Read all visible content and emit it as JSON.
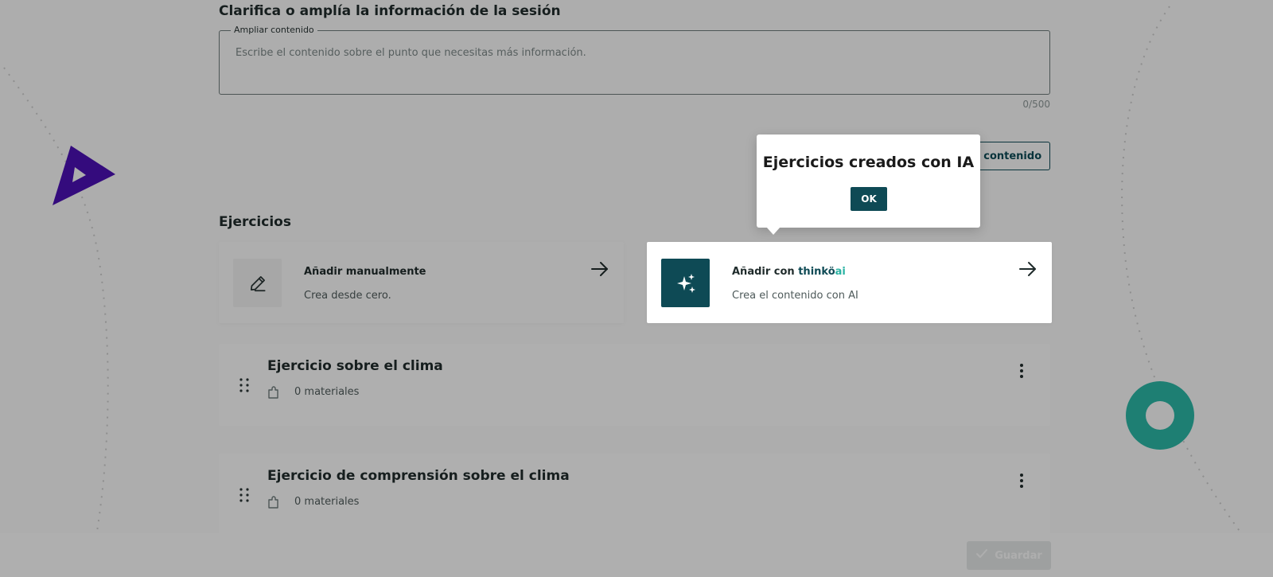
{
  "session": {
    "section_title": "Clarifica o amplía la información de la sesión",
    "textarea_label": "Ampliar contenido",
    "textarea_placeholder": "Escribe el contenido sobre el punto que necesitas más información.",
    "counter": "0/500",
    "expand_button": "ir contenido"
  },
  "exercises": {
    "section_title": "Ejercicios",
    "manual_card": {
      "title": "Añadir manualmente",
      "desc": "Crea desde cero.",
      "icon": "pencil-icon"
    },
    "ai_card": {
      "title_prefix": "Añadir con ",
      "brand": "thinkö",
      "brand_ai": "ai",
      "desc": "Crea el contenido con AI",
      "icon": "sparkles-icon"
    },
    "list": [
      {
        "title": "Ejercicio sobre el clima",
        "materials": "0 materiales"
      },
      {
        "title": "Ejercicio de comprensión sobre el clima",
        "materials": "0 materiales"
      }
    ]
  },
  "footer": {
    "save_label": "Guardar"
  },
  "popover": {
    "title": "Ejercicios creados con IA",
    "ok_label": "OK"
  },
  "colors": {
    "primary": "#0e4a55",
    "accent": "#2bb3a3",
    "deco_purple": "#4a10b0",
    "deco_teal": "#2bb3a3"
  }
}
